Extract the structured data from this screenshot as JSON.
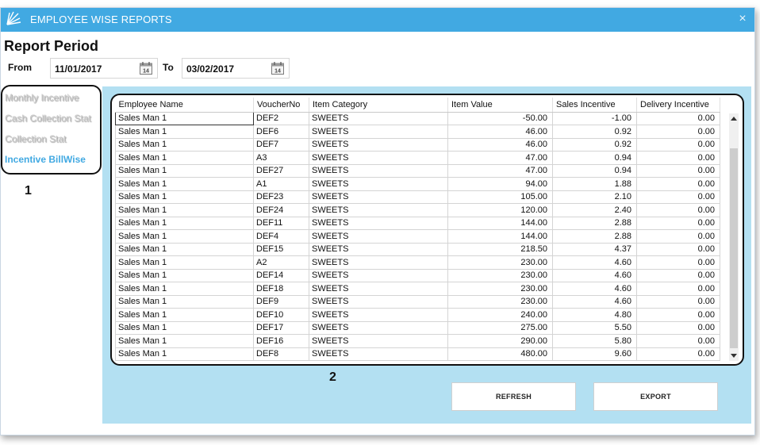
{
  "window": {
    "title": "EMPLOYEE WISE REPORTS",
    "close_glyph": "×",
    "icon": "app-sparkle-icon",
    "accent_color": "#41a9e2"
  },
  "report": {
    "title": "Report Period",
    "from_label": "From",
    "from_value": "11/01/2017",
    "to_label": "To",
    "to_value": "03/02/2017",
    "calendar_day": "14"
  },
  "nav": {
    "items": [
      {
        "label": "Monthly Incentive",
        "active": false
      },
      {
        "label": "Cash Collection Stat",
        "active": false
      },
      {
        "label": "Collection Stat",
        "active": false
      },
      {
        "label": "Incentive BillWise",
        "active": true
      }
    ]
  },
  "callouts": {
    "nav": "1",
    "grid": "2"
  },
  "grid": {
    "columns": [
      "Employee Name",
      "VoucherNo",
      "Item Category",
      "Item Value",
      "Sales Incentive",
      "Delivery Incentive"
    ],
    "rows": [
      [
        "Sales Man 1",
        "DEF2",
        "SWEETS",
        "-50.00",
        "-1.00",
        "0.00"
      ],
      [
        "Sales Man 1",
        "DEF6",
        "SWEETS",
        "46.00",
        "0.92",
        "0.00"
      ],
      [
        "Sales Man 1",
        "DEF7",
        "SWEETS",
        "46.00",
        "0.92",
        "0.00"
      ],
      [
        "Sales Man 1",
        "A3",
        "SWEETS",
        "47.00",
        "0.94",
        "0.00"
      ],
      [
        "Sales Man 1",
        "DEF27",
        "SWEETS",
        "47.00",
        "0.94",
        "0.00"
      ],
      [
        "Sales Man 1",
        "A1",
        "SWEETS",
        "94.00",
        "1.88",
        "0.00"
      ],
      [
        "Sales Man 1",
        "DEF23",
        "SWEETS",
        "105.00",
        "2.10",
        "0.00"
      ],
      [
        "Sales Man 1",
        "DEF24",
        "SWEETS",
        "120.00",
        "2.40",
        "0.00"
      ],
      [
        "Sales Man 1",
        "DEF11",
        "SWEETS",
        "144.00",
        "2.88",
        "0.00"
      ],
      [
        "Sales Man 1",
        "DEF4",
        "SWEETS",
        "144.00",
        "2.88",
        "0.00"
      ],
      [
        "Sales Man 1",
        "DEF15",
        "SWEETS",
        "218.50",
        "4.37",
        "0.00"
      ],
      [
        "Sales Man 1",
        "A2",
        "SWEETS",
        "230.00",
        "4.60",
        "0.00"
      ],
      [
        "Sales Man 1",
        "DEF14",
        "SWEETS",
        "230.00",
        "4.60",
        "0.00"
      ],
      [
        "Sales Man 1",
        "DEF18",
        "SWEETS",
        "230.00",
        "4.60",
        "0.00"
      ],
      [
        "Sales Man 1",
        "DEF9",
        "SWEETS",
        "230.00",
        "4.60",
        "0.00"
      ],
      [
        "Sales Man 1",
        "DEF10",
        "SWEETS",
        "240.00",
        "4.80",
        "0.00"
      ],
      [
        "Sales Man 1",
        "DEF17",
        "SWEETS",
        "275.00",
        "5.50",
        "0.00"
      ],
      [
        "Sales Man 1",
        "DEF16",
        "SWEETS",
        "290.00",
        "5.80",
        "0.00"
      ],
      [
        "Sales Man 1",
        "DEF8",
        "SWEETS",
        "480.00",
        "9.60",
        "0.00"
      ]
    ]
  },
  "buttons": {
    "refresh": "REFRESH",
    "export": "EXPORT"
  }
}
